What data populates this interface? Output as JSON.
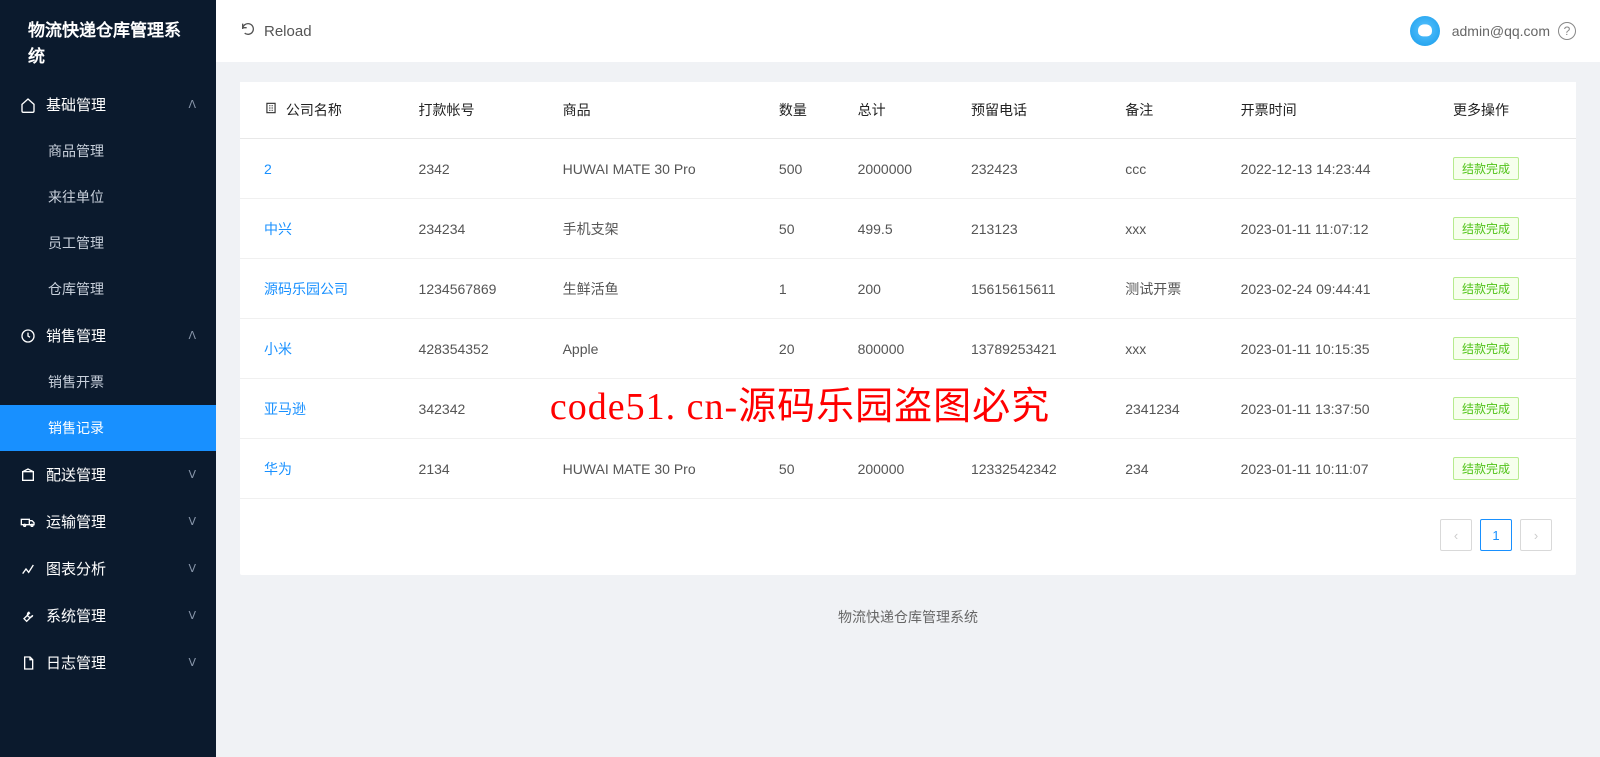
{
  "app": {
    "title": "物流快递仓库管理系统"
  },
  "topbar": {
    "reload": "Reload",
    "user_email": "admin@qq.com"
  },
  "sidebar": {
    "groups": [
      {
        "icon": "home-icon",
        "label": "基础管理",
        "expanded": true,
        "items": [
          "商品管理",
          "来往单位",
          "员工管理",
          "仓库管理"
        ]
      },
      {
        "icon": "clock-icon",
        "label": "销售管理",
        "expanded": true,
        "items": [
          "销售开票",
          "销售记录"
        ],
        "active_item": "销售记录"
      },
      {
        "icon": "package-icon",
        "label": "配送管理",
        "expanded": false
      },
      {
        "icon": "truck-icon",
        "label": "运输管理",
        "expanded": false
      },
      {
        "icon": "chart-icon",
        "label": "图表分析",
        "expanded": false
      },
      {
        "icon": "wrench-icon",
        "label": "系统管理",
        "expanded": false
      },
      {
        "icon": "document-icon",
        "label": "日志管理",
        "expanded": false
      }
    ]
  },
  "table": {
    "columns": [
      "公司名称",
      "打款帐号",
      "商品",
      "数量",
      "总计",
      "预留电话",
      "备注",
      "开票时间",
      "更多操作"
    ],
    "action_label": "结款完成",
    "rows": [
      {
        "company": "2",
        "account": "2342",
        "product": "HUWAI MATE 30 Pro",
        "qty": "500",
        "total": "2000000",
        "phone": "232423",
        "remark": "ccc",
        "time": "2022-12-13 14:23:44"
      },
      {
        "company": "中兴",
        "account": "234234",
        "product": "手机支架",
        "qty": "50",
        "total": "499.5",
        "phone": "213123",
        "remark": "xxx",
        "time": "2023-01-11 11:07:12"
      },
      {
        "company": "源码乐园公司",
        "account": "1234567869",
        "product": "生鲜活鱼",
        "qty": "1",
        "total": "200",
        "phone": "15615615611",
        "remark": "测试开票",
        "time": "2023-02-24 09:44:41"
      },
      {
        "company": "小米",
        "account": "428354352",
        "product": "Apple",
        "qty": "20",
        "total": "800000",
        "phone": "13789253421",
        "remark": "xxx",
        "time": "2023-01-11 10:15:35"
      },
      {
        "company": "亚马逊",
        "account": "342342",
        "product": "",
        "qty": "",
        "total": "",
        "phone": "",
        "remark": "2341234",
        "time": "2023-01-11 13:37:50"
      },
      {
        "company": "华为",
        "account": "2134",
        "product": "HUWAI MATE 30 Pro",
        "qty": "50",
        "total": "200000",
        "phone": "12332542342",
        "remark": "234",
        "time": "2023-01-11 10:11:07"
      }
    ]
  },
  "pagination": {
    "current": "1"
  },
  "footer": {
    "text": "物流快递仓库管理系统"
  },
  "watermark": "code51. cn-源码乐园盗图必究"
}
